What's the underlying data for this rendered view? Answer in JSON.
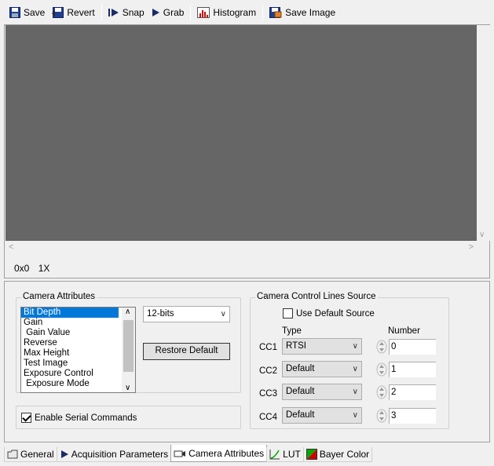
{
  "toolbar": {
    "save": "Save",
    "revert": "Revert",
    "snap": "Snap",
    "grab": "Grab",
    "histogram": "Histogram",
    "save_image": "Save Image"
  },
  "viewer": {
    "position": "0x0",
    "zoom": "1X"
  },
  "camera_attributes": {
    "legend": "Camera Attributes",
    "items": [
      "Bit Depth",
      "Gain",
      " Gain Value",
      "Reverse",
      "Max Height",
      "Test Image",
      "Exposure Control",
      " Exposure Mode"
    ],
    "selected": "Bit Depth",
    "value": "12-bits",
    "restore_label": "Restore Default",
    "serial_label": "Enable Serial Commands"
  },
  "control_lines": {
    "legend": "Camera Control Lines Source",
    "use_default_label": "Use Default Source",
    "type_header": "Type",
    "number_header": "Number",
    "rows": [
      {
        "label": "CC1",
        "type": "RTSI",
        "number": "0"
      },
      {
        "label": "CC2",
        "type": "Default",
        "number": "1"
      },
      {
        "label": "CC3",
        "type": "Default",
        "number": "2"
      },
      {
        "label": "CC4",
        "type": "Default",
        "number": "3"
      }
    ]
  },
  "tabs": [
    "General",
    "Acquisition Parameters",
    "Camera Attributes",
    "LUT",
    "Bayer Color"
  ],
  "colors": {
    "canvas": "#666666",
    "selection": "#0078d7"
  }
}
